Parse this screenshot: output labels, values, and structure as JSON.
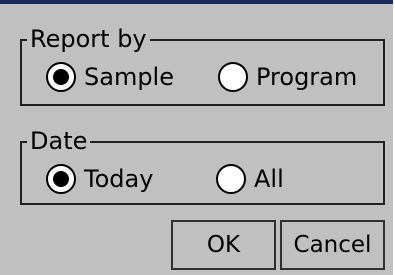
{
  "report_by": {
    "title": "Report by",
    "options": [
      {
        "label": "Sample",
        "selected": true
      },
      {
        "label": "Program",
        "selected": false
      }
    ]
  },
  "date": {
    "title": "Date",
    "options": [
      {
        "label": "Today",
        "selected": true
      },
      {
        "label": "All",
        "selected": false
      }
    ]
  },
  "buttons": {
    "ok": "OK",
    "cancel": "Cancel"
  },
  "colors": {
    "dialog_bg": "#c0c0c0",
    "title_bar": "#1c2a5a"
  }
}
